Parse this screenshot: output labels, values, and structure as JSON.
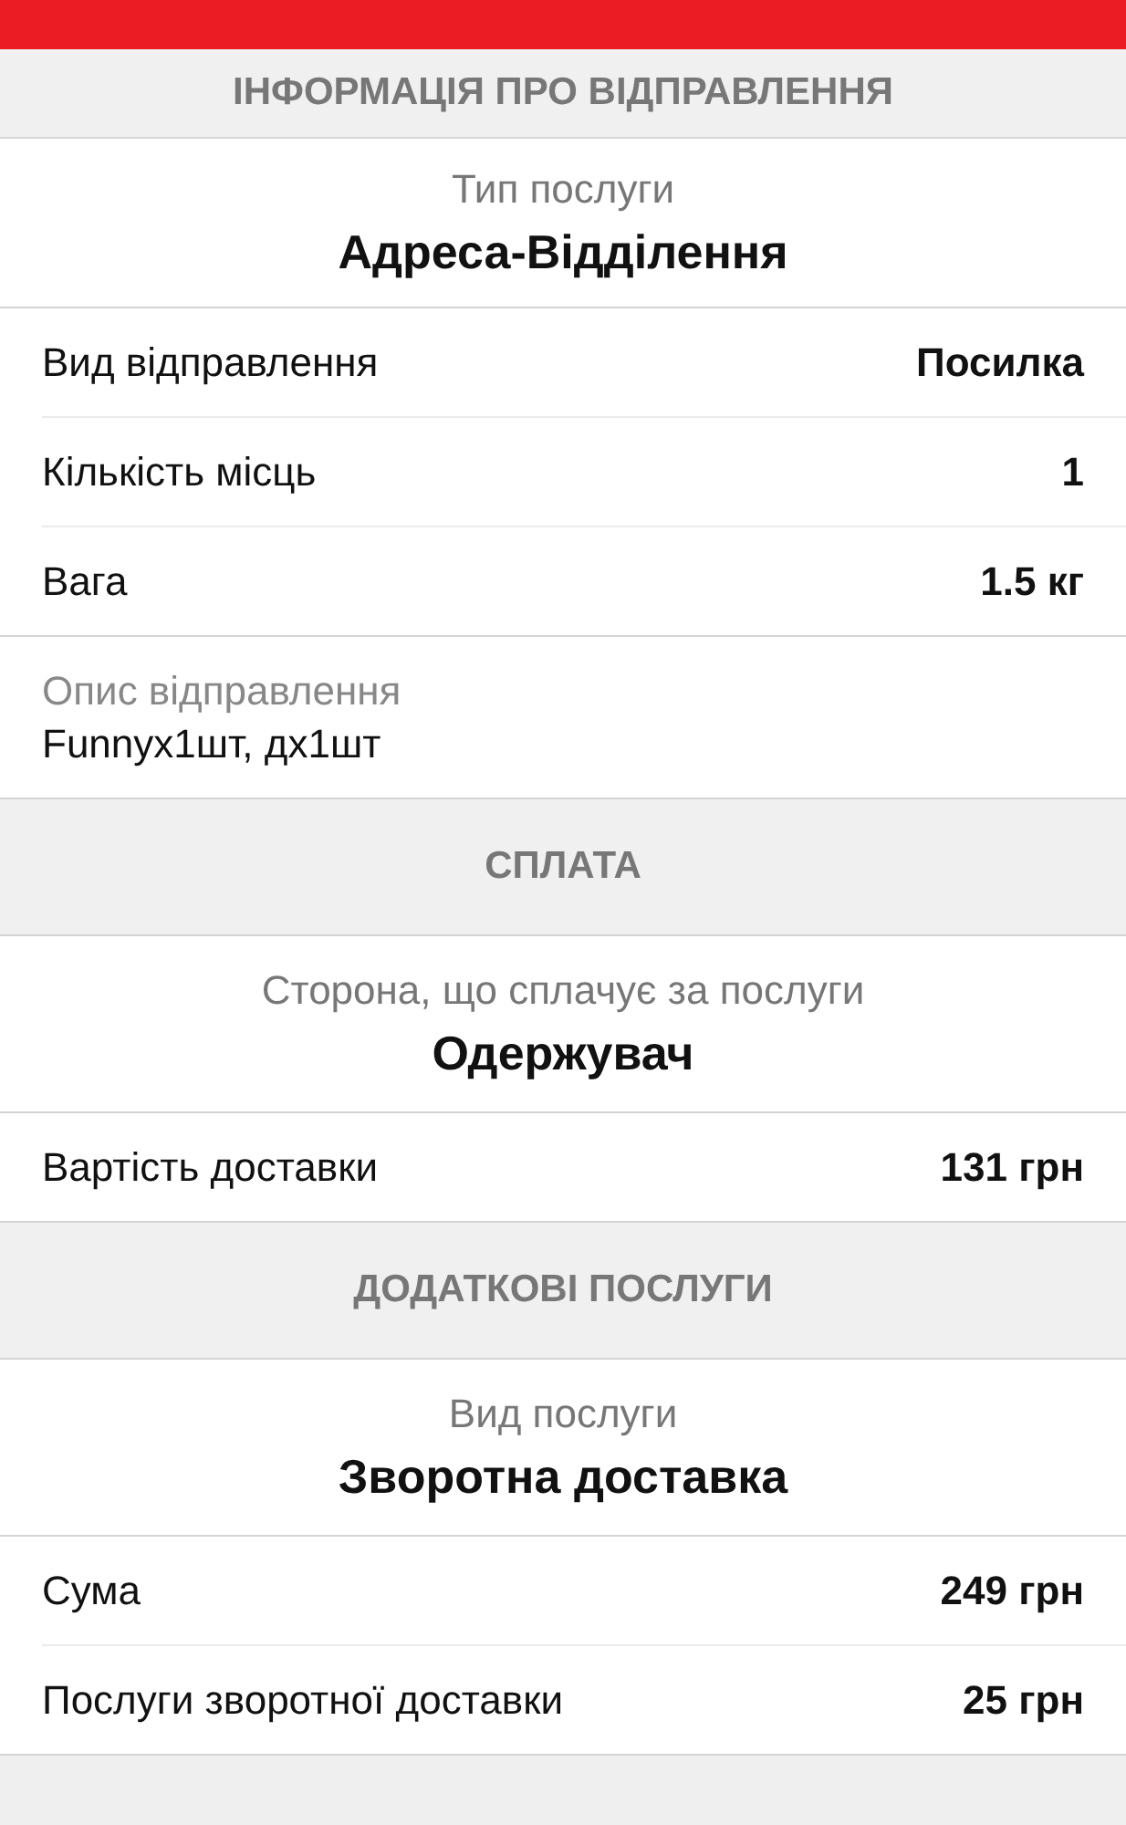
{
  "sections": [
    {
      "title": "ІНФОРМАЦІЯ ПРО ВІДПРАВЛЕННЯ",
      "blocks": [
        {
          "kind": "centered",
          "label": "Тип послуги",
          "value": "Адреса-Відділення"
        },
        {
          "kind": "rows",
          "items": [
            {
              "label": "Вид відправлення",
              "value": "Посилка"
            },
            {
              "label": "Кількість місць",
              "value": "1"
            },
            {
              "label": "Вага",
              "value": "1.5 кг"
            }
          ]
        },
        {
          "kind": "stacked",
          "label": "Опис відправлення",
          "value": "Funnyx1шт, дх1шт"
        }
      ]
    },
    {
      "title": "СПЛАТА",
      "blocks": [
        {
          "kind": "centered",
          "label": "Сторона, що сплачує за послуги",
          "value": "Одержувач"
        },
        {
          "kind": "rows",
          "items": [
            {
              "label": "Вартість доставки",
              "value": "131 грн"
            }
          ]
        }
      ]
    },
    {
      "title": "ДОДАТКОВІ ПОСЛУГИ",
      "blocks": [
        {
          "kind": "centered",
          "label": "Вид послуги",
          "value": "Зворотна доставка"
        },
        {
          "kind": "rows",
          "items": [
            {
              "label": "Сума",
              "value": "249 грн"
            },
            {
              "label": "Послуги зворотної доставки",
              "value": "25 грн"
            }
          ]
        }
      ]
    }
  ]
}
